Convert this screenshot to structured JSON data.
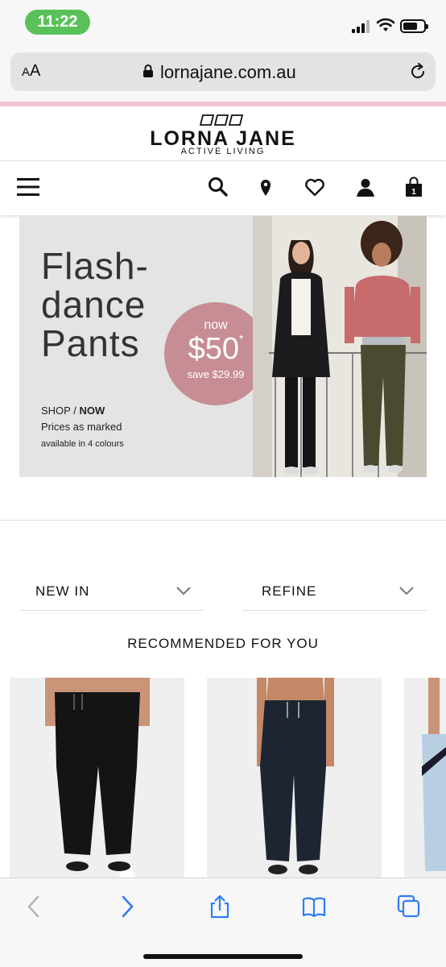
{
  "status_bar": {
    "time": "11:22",
    "time_pill_color": "#5ac15a"
  },
  "browser": {
    "text_size_label": "A",
    "text_size_label_large": "A",
    "url": "lornajane.com.au"
  },
  "site": {
    "brand_name": "LORNA JANE",
    "brand_tagline": "ACTIVE LIVING",
    "accent_color": "#efc5cf",
    "nav_icons": [
      "menu-icon",
      "search-icon",
      "location-pin-icon",
      "heart-icon",
      "account-icon",
      "shopping-bag-icon"
    ],
    "cart_count": "1"
  },
  "hero": {
    "title_lines": [
      "Flash-",
      "dance",
      "Pants"
    ],
    "shop_label": "SHOP /",
    "shop_now": "NOW",
    "prices_note": "Prices as marked",
    "colours_note": "available in 4 colours",
    "price_badge": {
      "now_label": "now",
      "price": "$50",
      "asterisk": "*",
      "save": "save $29.99",
      "color": "#c78d94"
    }
  },
  "filters": {
    "sort_label": "NEW IN",
    "refine_label": "REFINE"
  },
  "recommended": {
    "title": "RECOMMENDED FOR YOU"
  },
  "toolbar": {
    "icons": [
      "back-arrow-icon",
      "forward-arrow-icon",
      "share-icon",
      "bookmarks-icon",
      "tabs-icon"
    ],
    "accent_color": "#2f7cf6"
  }
}
